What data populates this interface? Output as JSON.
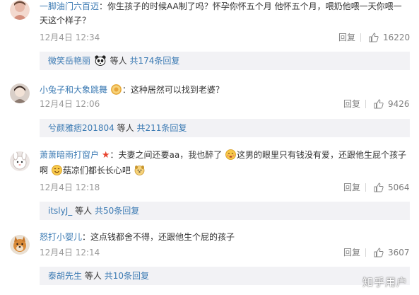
{
  "comments": [
    {
      "user": "一脚油门六百迈",
      "text_line1": "：你生孩子的时候AA制了吗？怀孕你怀五个月 他怀五个月，喂奶他喂一天你喂一",
      "text_line2": "天这个样子？",
      "time": "12月4日 12:34",
      "reply_label": "回复",
      "likes": "16220",
      "subreply": {
        "user": "微笑岳艳丽",
        "icon": "panda-emoji",
        "middle": "等人",
        "more": "共174条回复"
      }
    },
    {
      "user": "小兔子和大象跳舞",
      "badge_icon": "badge-icon",
      "text_line1": "：这种居然可以找到老婆？",
      "time": "12月4日 12:06",
      "reply_label": "回复",
      "likes": "9426",
      "subreply": {
        "user": "兮颜雅痞201804",
        "middle": "等人",
        "more": "共211条回复"
      }
    },
    {
      "user": "萧萧暗雨打窗户",
      "badge_icon": "star-icon",
      "text_line1_a": "：夫妻之间还要aa，我也醉了",
      "text_line1_b": "这男的眼里只有钱没有爱，还跟他生屁个孩子",
      "text_line2_a": "啊",
      "text_line2_b": "菇凉们都长长心吧",
      "time": "12月4日 12:18",
      "reply_label": "回复",
      "likes": "5064",
      "subreply": {
        "user": "itslyJ_",
        "middle": "等人",
        "more": "共50条回复"
      }
    },
    {
      "user": "怒打小婴儿",
      "text_line1": "：这点钱都舍不得，还跟他生个屁的孩子",
      "time": "12月4日 12:14",
      "reply_label": "回复",
      "likes": "3607",
      "subreply": {
        "user": "泰胡先生",
        "middle": "等人",
        "more": "共10条回复"
      }
    }
  ],
  "watermark": "知乎用户",
  "colors": {
    "link": "#3b7ab3",
    "meta": "#999999",
    "subbox_bg": "#f2f2f5"
  }
}
